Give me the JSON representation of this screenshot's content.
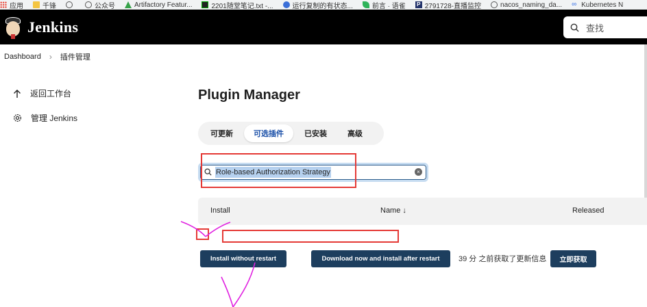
{
  "bookmarks": [
    {
      "label": "应用",
      "icon": "apps-grid-icon"
    },
    {
      "label": "千锋",
      "icon": "folder-icon"
    },
    {
      "label": "",
      "icon": "globe-icon"
    },
    {
      "label": "公众号",
      "icon": "globe-icon"
    },
    {
      "label": "Artifactory Featur...",
      "icon": "artifactory-icon"
    },
    {
      "label": "2201随堂笔记.txt -...",
      "icon": "terminal-icon"
    },
    {
      "label": "运行复制的有状态...",
      "icon": "kubernetes-icon"
    },
    {
      "label": "前言 · 语雀",
      "icon": "yuque-icon"
    },
    {
      "label": "2791728-直播监控",
      "icon": "p-icon"
    },
    {
      "label": "nacos_naming_da...",
      "icon": "globe-icon"
    },
    {
      "label": "Kubernetes N",
      "icon": "kubernetes-icon"
    }
  ],
  "header": {
    "brand": "Jenkins",
    "search_placeholder": "查找"
  },
  "breadcrumb": {
    "items": [
      "Dashboard",
      "插件管理"
    ]
  },
  "sidebar": {
    "items": [
      {
        "label": "返回工作台",
        "icon": "arrow-up-icon"
      },
      {
        "label": "管理 Jenkins",
        "icon": "gear-icon"
      }
    ]
  },
  "main": {
    "title": "Plugin Manager",
    "tabs": [
      {
        "label": "可更新",
        "active": false
      },
      {
        "label": "可选插件",
        "active": true
      },
      {
        "label": "已安装",
        "active": false
      },
      {
        "label": "高级",
        "active": false
      }
    ],
    "filter": {
      "value": "Role-based Authorization Strategy"
    },
    "table": {
      "headers": [
        "Install",
        "Name ↓",
        "Released"
      ]
    },
    "buttons": {
      "install_without_restart": "Install without restart",
      "download_install_after_restart": "Download now and install after restart",
      "fetch_now": "立即获取"
    },
    "update_info": "39 分 之前获取了更新信息"
  },
  "colors": {
    "header_bg": "#000000",
    "button_bg": "#1d3e5e",
    "active_tab_text": "#1a4fa8",
    "annotation_red": "#e53935",
    "annotation_magenta": "#e020e0"
  }
}
